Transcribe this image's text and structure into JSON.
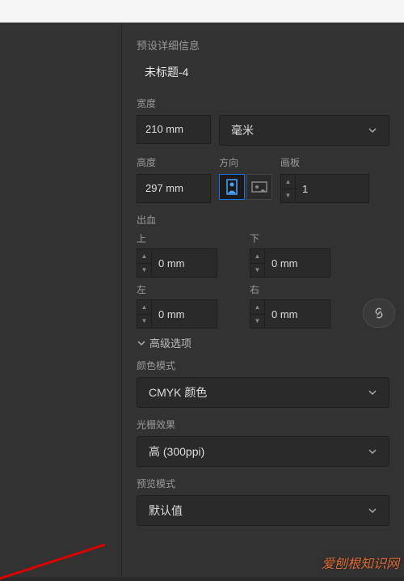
{
  "header": {
    "title": "预设详细信息"
  },
  "docTitle": "未标题-4",
  "width": {
    "label": "宽度",
    "value": "210 mm"
  },
  "units": {
    "selected": "毫米"
  },
  "height": {
    "label": "高度",
    "value": "297 mm"
  },
  "orientation": {
    "label": "方向"
  },
  "artboard": {
    "label": "画板",
    "value": "1"
  },
  "bleed": {
    "label": "出血",
    "top": {
      "label": "上",
      "value": "0 mm"
    },
    "bottom": {
      "label": "下",
      "value": "0 mm"
    },
    "left": {
      "label": "左",
      "value": "0 mm"
    },
    "right": {
      "label": "右",
      "value": "0 mm"
    }
  },
  "advanced": {
    "label": "高级选项"
  },
  "colorMode": {
    "label": "颜色模式",
    "selected": "CMYK 颜色"
  },
  "raster": {
    "label": "光栅效果",
    "selected": "高 (300ppi)"
  },
  "preview": {
    "label": "预览模式",
    "selected": "默认值"
  },
  "watermark": "爱刨根知识网"
}
